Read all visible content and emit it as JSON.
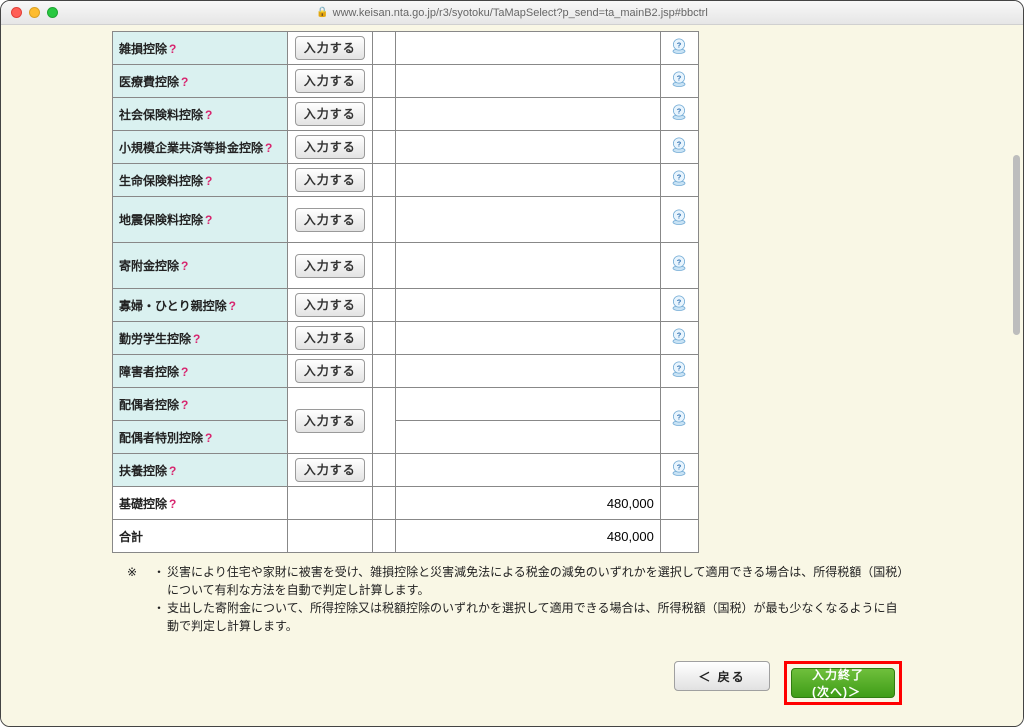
{
  "window": {
    "url": "www.keisan.nta.go.jp/r3/syotoku/TaMapSelect?p_send=ta_mainB2.jsp#bbctrl"
  },
  "btn_label": "入力する",
  "rows": [
    {
      "label": "雑損控除",
      "q": true,
      "btn": true,
      "help": true
    },
    {
      "label": "医療費控除",
      "q": true,
      "btn": true,
      "help": true
    },
    {
      "label": "社会保険料控除",
      "q": true,
      "btn": true,
      "help": true
    },
    {
      "label": "小規模企業共済等掛金控除",
      "q": true,
      "btn": true,
      "help": true
    },
    {
      "label": "生命保険料控除",
      "q": true,
      "btn": true,
      "help": true
    },
    {
      "label": "地震保険料控除",
      "q": true,
      "btn": true,
      "help": true,
      "tall": true
    },
    {
      "label": "寄附金控除",
      "q": true,
      "btn": true,
      "help": true,
      "tall": true
    },
    {
      "label": "寡婦・ひとり親控除",
      "q": true,
      "btn": true,
      "help": true,
      "gapBefore": true
    },
    {
      "label": "勤労学生控除",
      "q": true,
      "btn": true,
      "help": true
    },
    {
      "label": "障害者控除",
      "q": true,
      "btn": true,
      "help": true
    }
  ],
  "spouse": {
    "label1": "配偶者控除",
    "label2": "配偶者特別控除",
    "q": true,
    "help": true
  },
  "fuyo": {
    "label": "扶養控除",
    "q": true,
    "btn": true,
    "help": true
  },
  "kiso": {
    "label": "基礎控除",
    "q": true,
    "value": "480,000"
  },
  "total": {
    "label": "合計",
    "value": "480,000"
  },
  "notes": {
    "prefix": "※",
    "bullets": [
      "災害により住宅や家財に被害を受け、雑損控除と災害減免法による税金の減免のいずれかを選択して適用できる場合は、所得税額（国税）について有利な方法を自動で判定し計算します。",
      "支出した寄附金について、所得控除又は税額控除のいずれかを選択して適用できる場合は、所得税額（国税）が最も少なくなるように自動で判定し計算します。"
    ]
  },
  "nav": {
    "back": "＜ 戻る",
    "next": "入力終了(次へ)＞"
  }
}
